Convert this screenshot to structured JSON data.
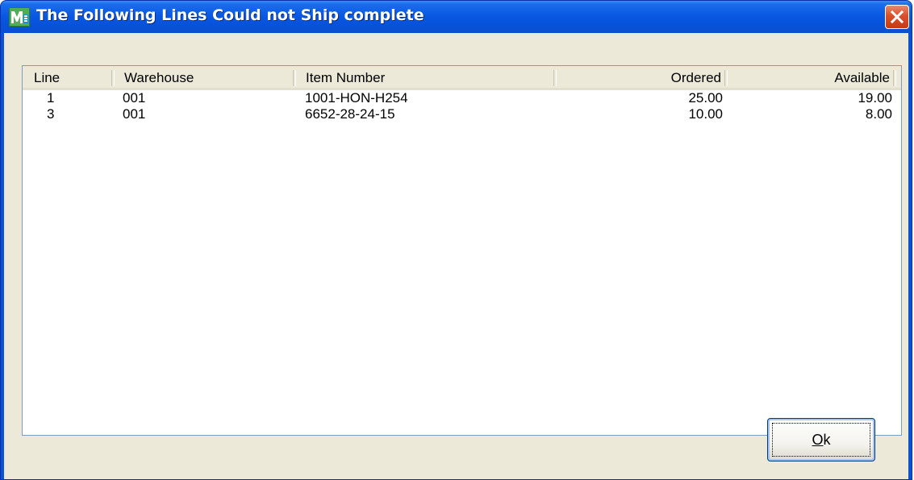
{
  "window": {
    "title": "The Following Lines Could not Ship complete",
    "icon": "mas-app-icon",
    "close_icon": "close-icon"
  },
  "list": {
    "columns": [
      "Line",
      "Warehouse",
      "Item Number",
      "Ordered",
      "Available"
    ],
    "rows": [
      {
        "line": "1",
        "warehouse": "001",
        "item_number": "1001-HON-H254",
        "ordered": "25.00",
        "available": "19.00"
      },
      {
        "line": "3",
        "warehouse": "001",
        "item_number": "6652-28-24-15",
        "ordered": "10.00",
        "available": "8.00"
      }
    ]
  },
  "buttons": {
    "ok_mnemonic": "O",
    "ok_rest": "k"
  },
  "colors": {
    "titlebar": "#0a59e3",
    "close": "#d9502a",
    "dialog_bg": "#ece9d8"
  }
}
